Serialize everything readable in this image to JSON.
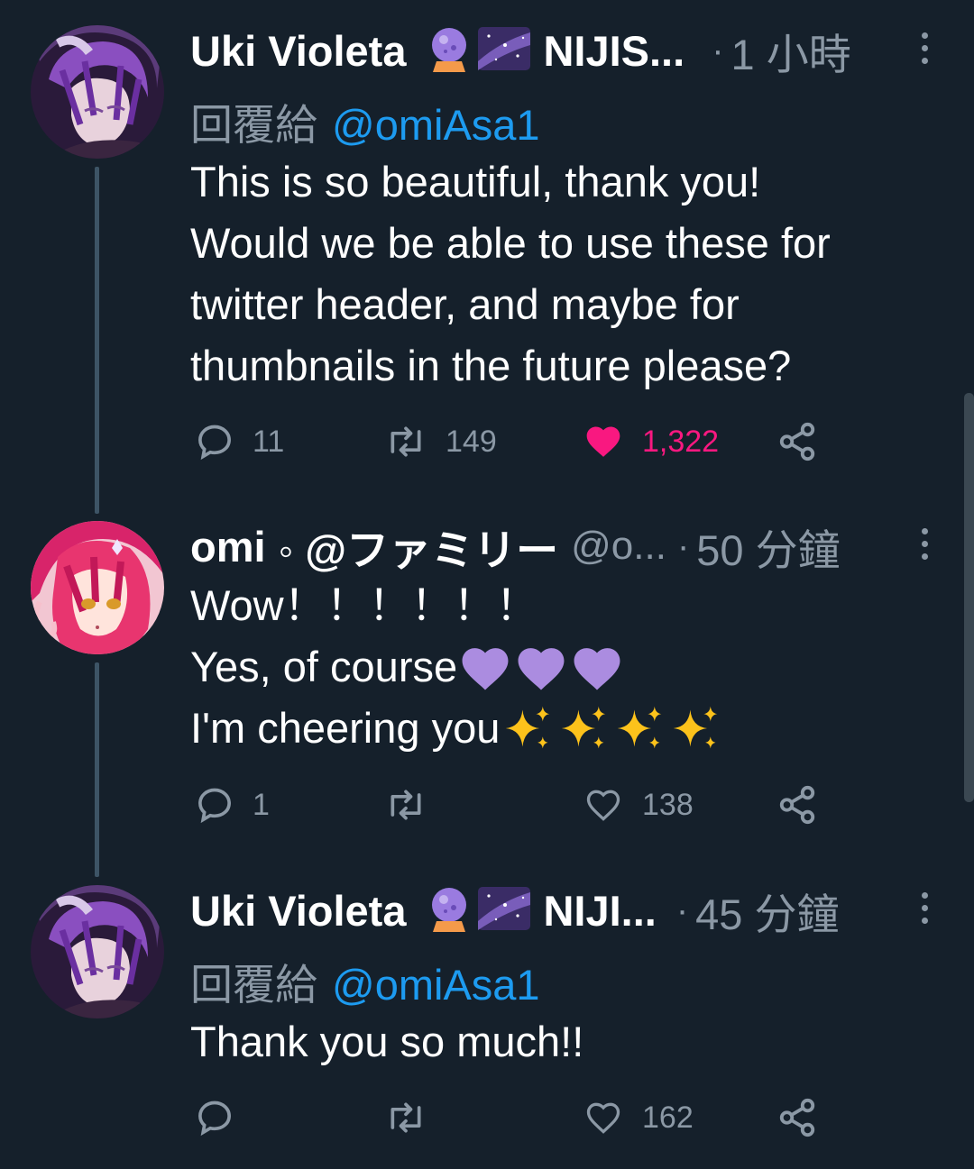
{
  "tweets": [
    {
      "author": "Uki Violeta",
      "emojis": [
        "crystal-ball-emoji",
        "milky-way-emoji"
      ],
      "author_suffix": "NIJIS...",
      "separator": "·",
      "time": "1 小時",
      "reply_label": "回覆給",
      "reply_to": "@omiAsa1",
      "lines": [
        "This is so beautiful, thank you!",
        "Would we be able to use these for",
        "twitter header, and maybe for",
        "thumbnails in the future please?"
      ],
      "replies": "11",
      "retweets": "149",
      "likes": "1,322",
      "liked": true
    },
    {
      "author": "omi",
      "author_suffix": "◦ @ファミリー",
      "handle": "@o...",
      "separator": "·",
      "time": "50 分鐘",
      "lines": [
        "Wow！！！！！！",
        "Yes, of course",
        "I'm cheering you"
      ],
      "emojis": [
        "purple-heart-emoji",
        "sparkles-emoji"
      ],
      "replies": "1",
      "retweets": "",
      "likes": "138",
      "liked": false
    },
    {
      "author": "Uki Violeta",
      "emojis": [
        "crystal-ball-emoji",
        "milky-way-emoji"
      ],
      "author_suffix": "NIJI...",
      "separator": "·",
      "time": "45 分鐘",
      "reply_label": "回覆給",
      "reply_to": "@omiAsa1",
      "lines": [
        "Thank you so much!!"
      ],
      "replies": "",
      "retweets": "",
      "likes": "162",
      "liked": false
    }
  ],
  "colors": {
    "background": "#15202b",
    "secondary_text": "#8b98a5",
    "mention": "#1d9bf0",
    "like_active": "#f91880",
    "purple_heart": "#ab8ce0",
    "sparkle": "#fcc21b"
  }
}
